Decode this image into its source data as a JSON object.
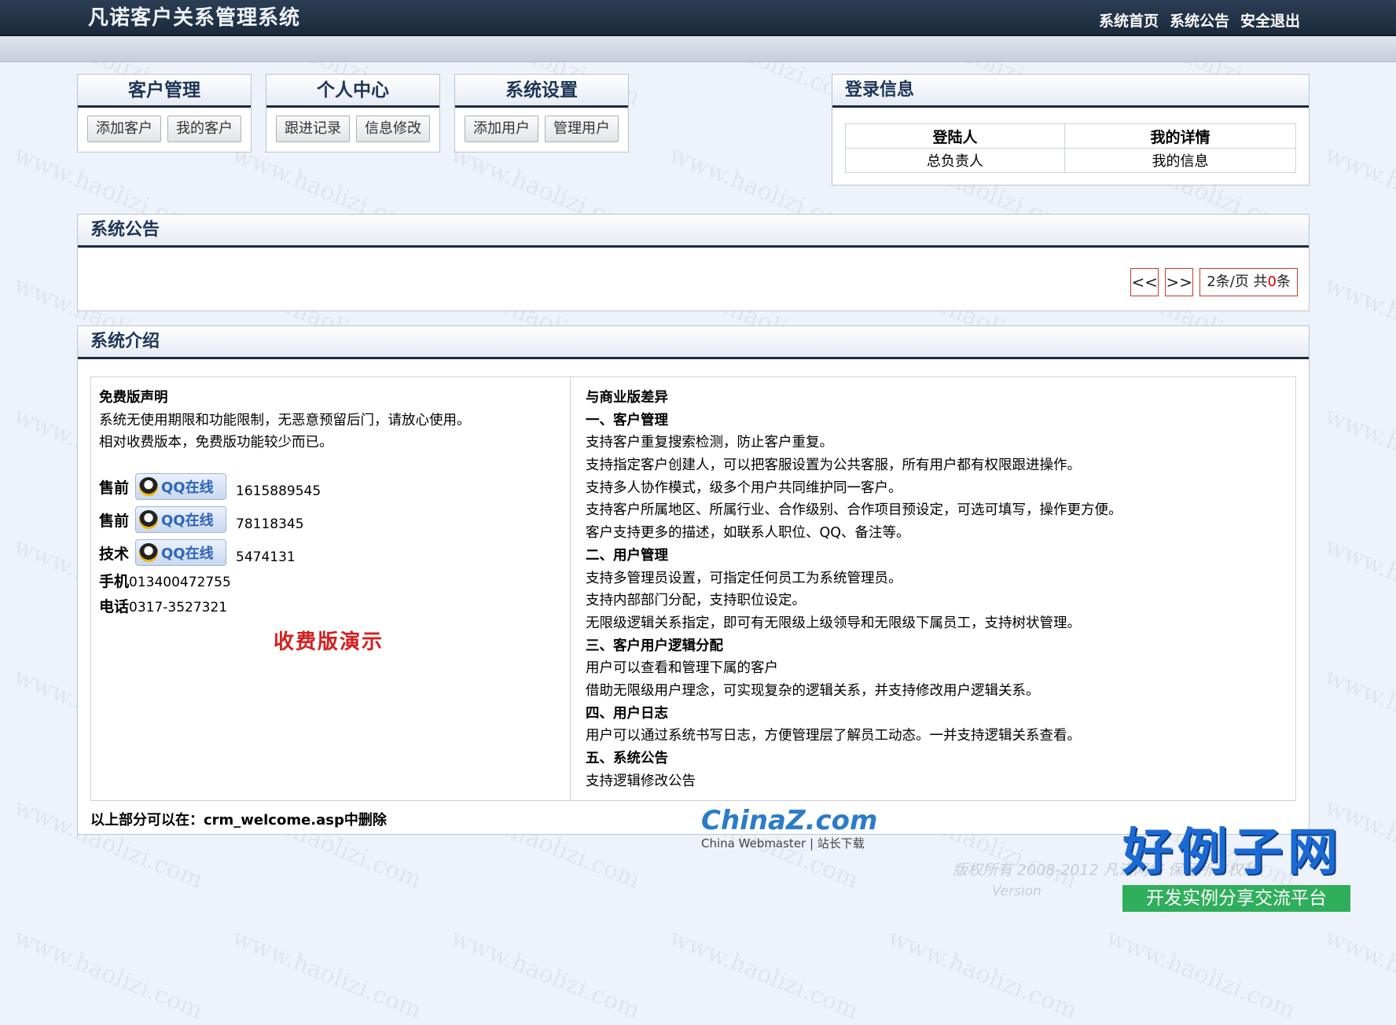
{
  "header": {
    "title": "凡诺客户关系管理系统",
    "links": [
      "系统首页",
      "系统公告",
      "安全退出"
    ]
  },
  "menus": [
    {
      "title": "客户管理",
      "buttons": [
        "添加客户",
        "我的客户"
      ]
    },
    {
      "title": "个人中心",
      "buttons": [
        "跟进记录",
        "信息修改"
      ]
    },
    {
      "title": "系统设置",
      "buttons": [
        "添加用户",
        "管理用户"
      ]
    }
  ],
  "login_info": {
    "title": "登录信息",
    "headers": [
      "登陆人",
      "我的详情"
    ],
    "values": [
      "总负责人",
      "我的信息"
    ]
  },
  "announcement": {
    "title": "系统公告",
    "prev": "<<",
    "next": ">>",
    "per_page": "2条/页 共",
    "count": "0",
    "unit": "条"
  },
  "intro": {
    "title": "系统介绍",
    "left": {
      "heading": "免费版声明",
      "lines": [
        "系统无使用期限和功能限制，无恶意预留后门，请放心使用。",
        "相对收费版本，免费版功能较少而已。"
      ],
      "contacts": [
        {
          "label": "售前",
          "button": "QQ在线",
          "number": "1615889545"
        },
        {
          "label": "售前",
          "button": "QQ在线",
          "number": "78118345"
        },
        {
          "label": "技术",
          "button": "QQ在线",
          "number": "5474131"
        }
      ],
      "mobile_label": "手机",
      "mobile": "013400472755",
      "phone_label": "电话",
      "phone": "0317-3527321",
      "demo_link": "收费版演示"
    },
    "right": {
      "heading": "与商业版差异",
      "lines": [
        {
          "text": "一、客户管理",
          "bold": true
        },
        {
          "text": "支持客户重复搜索检测，防止客户重复。",
          "bold": false
        },
        {
          "text": "支持指定客户创建人，可以把客服设置为公共客服，所有用户都有权限跟进操作。",
          "bold": false
        },
        {
          "text": "支持多人协作模式，级多个用户共同维护同一客户。",
          "bold": false
        },
        {
          "text": "支持客户所属地区、所属行业、合作级别、合作项目预设定，可选可填写，操作更方便。",
          "bold": false
        },
        {
          "text": "客户支持更多的描述，如联系人职位、QQ、备注等。",
          "bold": false
        },
        {
          "text": "二、用户管理",
          "bold": true
        },
        {
          "text": "支持多管理员设置，可指定任何员工为系统管理员。",
          "bold": false
        },
        {
          "text": "支持内部部门分配，支持职位设定。",
          "bold": false
        },
        {
          "text": "无限级逻辑关系指定，即可有无限级上级领导和无限级下属员工，支持树状管理。",
          "bold": false
        },
        {
          "text": "三、客户用户逻辑分配",
          "bold": true
        },
        {
          "text": "用户可以查看和管理下属的客户",
          "bold": false
        },
        {
          "text": "借助无限级用户理念，可实现复杂的逻辑关系，并支持修改用户逻辑关系。",
          "bold": false
        },
        {
          "text": "四、用户日志",
          "bold": true
        },
        {
          "text": "用户可以通过系统书写日志，方便管理层了解员工动态。一并支持逻辑关系查看。",
          "bold": false
        },
        {
          "text": "五、系统公告",
          "bold": true
        },
        {
          "text": "支持逻辑修改公告",
          "bold": false
        }
      ]
    },
    "footnote": "以上部分可以在：crm_welcome.asp中删除"
  },
  "footer": {
    "copyright": "版权所有 2008-2012 凡诺网络 保留所有权利",
    "version": "Version",
    "logo_big": "好例子网",
    "logo_small": "开发实例分享交流平台"
  },
  "overlay": {
    "chinaz_title": "ChinaZ.com",
    "chinaz_sub": "China Webmaster | 站长下载"
  },
  "watermark_text": "www.haolizi.com",
  "colors": {
    "header_bg": "#1b2a3c",
    "panel_border": "#1d2b3b",
    "title_text": "#1e3556",
    "pager_border": "#c0392b",
    "demo_red": "#d42020",
    "logo_blue": "#1b6ad4",
    "logo_green": "#2fae5b"
  }
}
